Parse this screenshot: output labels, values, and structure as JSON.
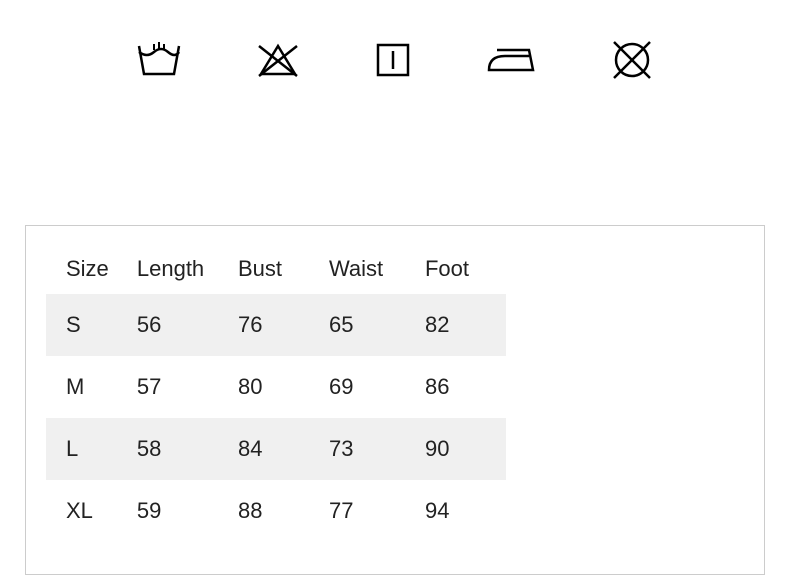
{
  "care_icons": [
    "wash-icon",
    "do-not-bleach-icon",
    "dry-icon",
    "iron-icon",
    "do-not-dry-clean-icon"
  ],
  "size_table": {
    "headers": {
      "size": "Size",
      "length": "Length",
      "bust": "Bust",
      "waist": "Waist",
      "foot": "Foot"
    },
    "rows": [
      {
        "size": "S",
        "length": "56",
        "bust": "76",
        "waist": "65",
        "foot": "82"
      },
      {
        "size": "M",
        "length": "57",
        "bust": "80",
        "waist": "69",
        "foot": "86"
      },
      {
        "size": "L",
        "length": "58",
        "bust": "84",
        "waist": "73",
        "foot": "90"
      },
      {
        "size": "XL",
        "length": "59",
        "bust": "88",
        "waist": "77",
        "foot": "94"
      }
    ]
  },
  "chart_data": {
    "type": "table",
    "title": "",
    "columns": [
      "Size",
      "Length",
      "Bust",
      "Waist",
      "Foot"
    ],
    "rows": [
      [
        "S",
        56,
        76,
        65,
        82
      ],
      [
        "M",
        57,
        80,
        69,
        86
      ],
      [
        "L",
        58,
        84,
        73,
        90
      ],
      [
        "XL",
        59,
        88,
        77,
        94
      ]
    ]
  }
}
